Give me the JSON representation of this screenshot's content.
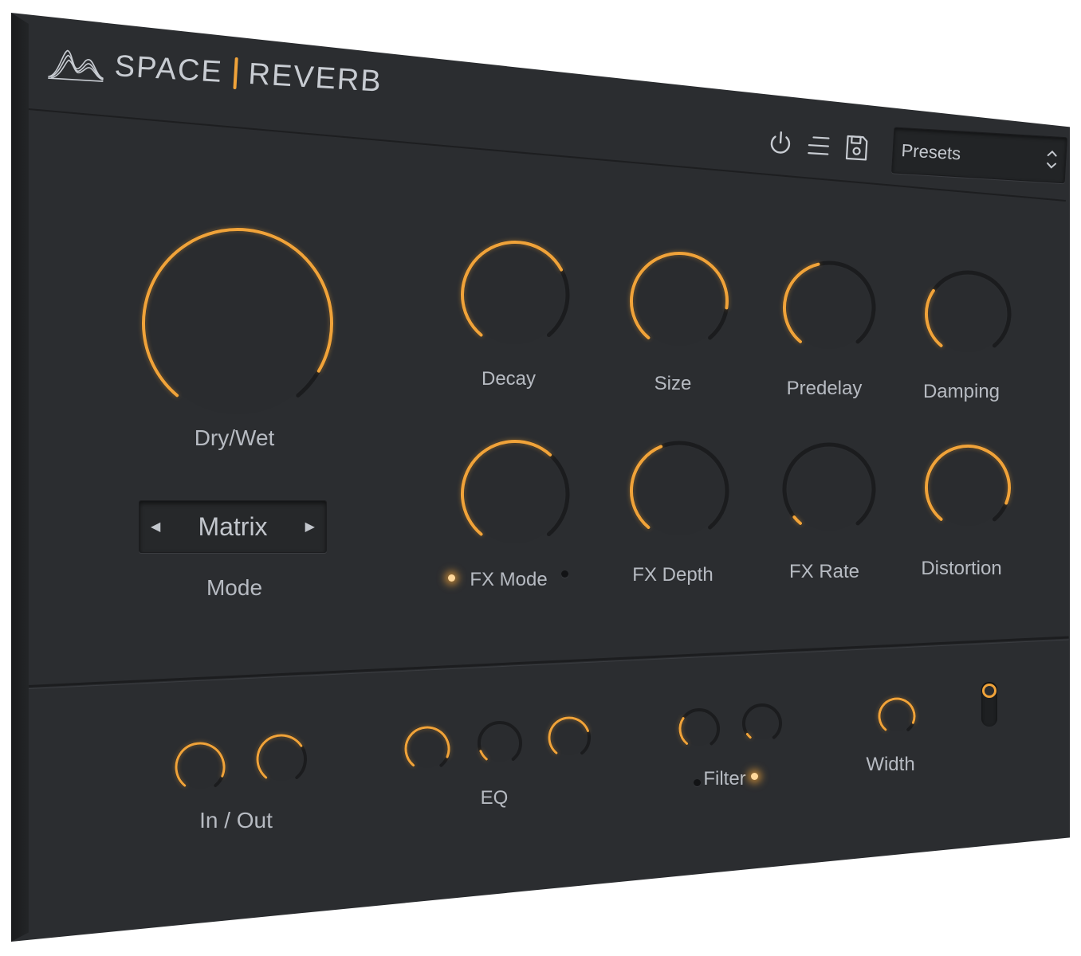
{
  "app": {
    "title_left": "SPACE",
    "title_right": "REVERB"
  },
  "toolbar": {
    "power_icon": "power-icon",
    "menu_icon": "menu-icon",
    "save_icon": "save-icon",
    "presets_label": "Presets",
    "presets_arrows": "⌃⌄"
  },
  "colors": {
    "accent": "#f0a33a",
    "panel": "#2b2d30",
    "label": "#b7bbc2"
  },
  "main": {
    "drywet": {
      "label": "Dry/Wet",
      "value": 0.93
    },
    "mode": {
      "label": "Mode",
      "value": "Matrix",
      "prev": "◀",
      "next": "▶"
    },
    "knobs": [
      {
        "id": "decay",
        "label": "Decay",
        "value": 0.72
      },
      {
        "id": "size",
        "label": "Size",
        "value": 0.85
      },
      {
        "id": "predelay",
        "label": "Predelay",
        "value": 0.45
      },
      {
        "id": "damping",
        "label": "Damping",
        "value": 0.3
      },
      {
        "id": "fx-mode",
        "label": "FX Mode",
        "value": 0.65
      },
      {
        "id": "fx-depth",
        "label": "FX Depth",
        "value": 0.42
      },
      {
        "id": "fx-rate",
        "label": "FX Rate",
        "value": 0.04
      },
      {
        "id": "distortion",
        "label": "Distortion",
        "value": 0.9
      }
    ]
  },
  "bottom": {
    "in_out": {
      "label": "In / Out",
      "knobs": [
        0.9,
        0.7
      ]
    },
    "eq": {
      "label": "EQ",
      "knobs": [
        0.9,
        0.1,
        0.75
      ]
    },
    "filter": {
      "label": "Filter",
      "knobs": [
        0.3,
        0.05
      ]
    },
    "width": {
      "label": "Width",
      "value": 0.9
    }
  }
}
